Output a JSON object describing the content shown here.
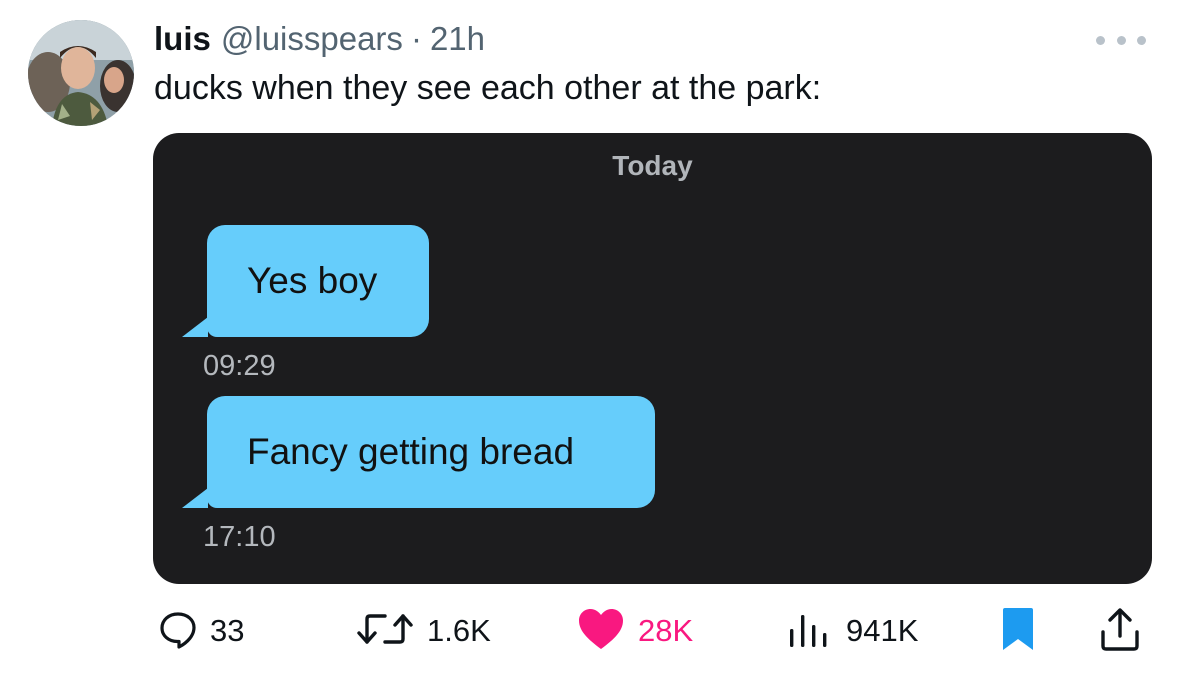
{
  "tweet": {
    "display_name": "luis",
    "handle": "@luisspears",
    "separator": "·",
    "time_ago": "21h",
    "text": "ducks when they see each other at the park:"
  },
  "media": {
    "date_label": "Today",
    "messages": [
      {
        "text": "Yes boy",
        "time": "09:29"
      },
      {
        "text": "Fancy getting bread",
        "time": "17:10"
      }
    ],
    "bubble_color": "#66cdfb",
    "background_color": "#1c1c1e"
  },
  "actions": {
    "replies": "33",
    "retweets": "1.6K",
    "likes": "28K",
    "views": "941K",
    "liked": true,
    "bookmarked": true,
    "like_color": "#f91880",
    "bookmark_color": "#1d9bf0",
    "icons": [
      "reply-icon",
      "retweet-icon",
      "heart-icon",
      "views-icon",
      "bookmark-icon",
      "share-icon"
    ]
  }
}
